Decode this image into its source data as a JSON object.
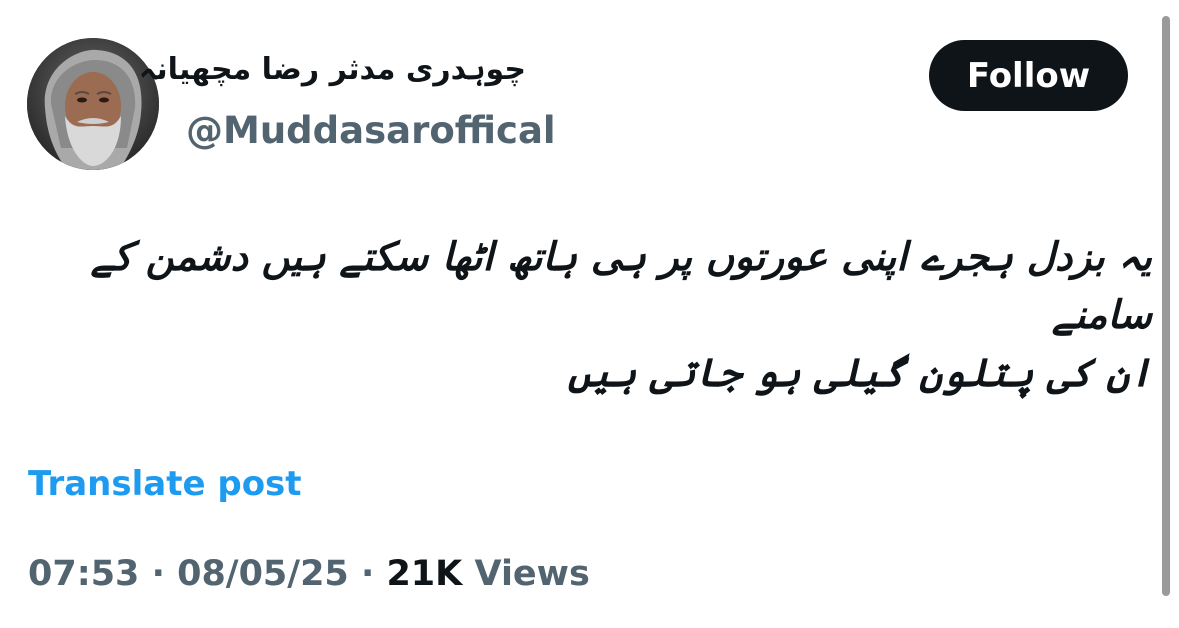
{
  "author": {
    "display_name": "چوہدری مدثر رضا مچھیانہ",
    "handle": "@Muddasaroffical",
    "avatar_icon": "profile-photo-avatar"
  },
  "follow_button": {
    "label": "Follow"
  },
  "post": {
    "text_line_1": "یہ بزدل ہجرے اپنی عورتوں پر ہی ہاتھ اٹھا سکتے ہیں دشمن کے سامنے",
    "text_line_2": "ان کی پتلون گیلی ہو جاتی ہیں"
  },
  "translate": {
    "label": "Translate post"
  },
  "meta": {
    "time": "07:53",
    "separator": " · ",
    "date": "08/05/25",
    "views_count": "21K",
    "views_label": " Views"
  },
  "colors": {
    "text_primary": "#0f1419",
    "text_secondary": "#536471",
    "link": "#1d9bf0",
    "button_bg": "#0f1419",
    "button_text": "#ffffff"
  }
}
